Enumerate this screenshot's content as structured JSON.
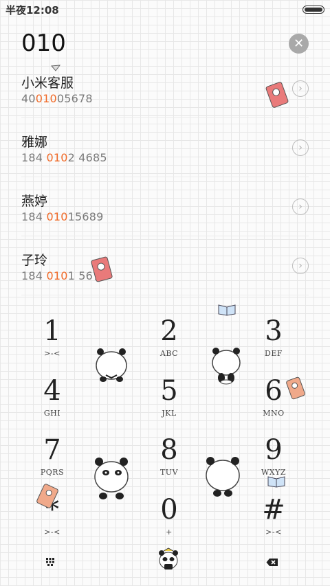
{
  "status_bar": {
    "time": "半夜12:08"
  },
  "dialer": {
    "input": "010"
  },
  "contacts": [
    {
      "name": "小米客服",
      "number_pre": "40",
      "number_hl": "010",
      "number_post": "05678"
    },
    {
      "name": "雅娜",
      "number_pre": "184 ",
      "number_hl": "010",
      "number_post": "2 4685"
    },
    {
      "name": "燕婷",
      "number_pre": "184 ",
      "number_hl": "010",
      "number_post": "15689"
    },
    {
      "name": "子玲",
      "number_pre": "184 ",
      "number_hl": "010",
      "number_post": "1 5678"
    }
  ],
  "keypad": [
    {
      "digit": "1",
      "letters": ">-<"
    },
    {
      "digit": "2",
      "letters": "ABC"
    },
    {
      "digit": "3",
      "letters": "DEF"
    },
    {
      "digit": "4",
      "letters": "GHI"
    },
    {
      "digit": "5",
      "letters": "JKL"
    },
    {
      "digit": "6",
      "letters": "MNO"
    },
    {
      "digit": "7",
      "letters": "PQRS"
    },
    {
      "digit": "8",
      "letters": "TUV"
    },
    {
      "digit": "9",
      "letters": "WXYZ"
    },
    {
      "digit": "*",
      "letters": ">-<"
    },
    {
      "digit": "0",
      "letters": "+"
    },
    {
      "digit": "#",
      "letters": ">-<"
    }
  ],
  "colors": {
    "highlight": "#f06a28",
    "clear_button": "#a9a9a9"
  },
  "icons": {
    "clear": "close-icon",
    "chevron": "chevron-right-icon",
    "keypad_toggle": "keypad-icon",
    "call": "panda-call-icon",
    "backspace": "backspace-icon"
  }
}
